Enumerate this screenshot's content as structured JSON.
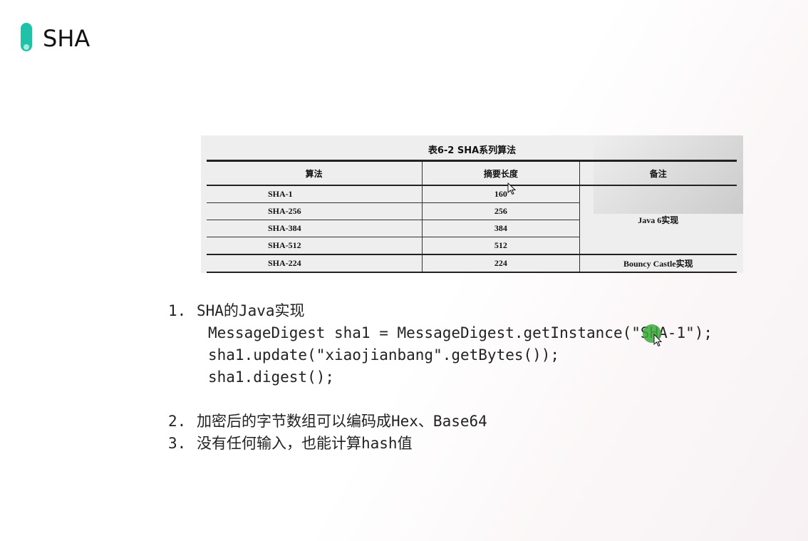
{
  "slide": {
    "title": "SHA",
    "accent_color": "#1fc1a8"
  },
  "table": {
    "caption": "表6-2  SHA系列算法",
    "headers": [
      "算法",
      "摘要长度",
      "备注"
    ],
    "rows": [
      {
        "algorithm": "SHA-1",
        "length": "160"
      },
      {
        "algorithm": "SHA-256",
        "length": "256"
      },
      {
        "algorithm": "SHA-384",
        "length": "384"
      },
      {
        "algorithm": "SHA-512",
        "length": "512"
      },
      {
        "algorithm": "SHA-224",
        "length": "224"
      }
    ],
    "note_java": "Java 6实现",
    "note_bc": "Bouncy Castle实现"
  },
  "list": {
    "item1_num": "1.",
    "item1_text": "SHA的Java实现",
    "code_line1": "MessageDigest sha1 = MessageDigest.getInstance(\"SHA-1\");",
    "code_line2": "sha1.update(\"xiaojianbang\".getBytes());",
    "code_line3": "sha1.digest();",
    "item2_num": "2.",
    "item2_text": "加密后的字节数组可以编码成Hex、Base64",
    "item3_num": "3.",
    "item3_text": "没有任何输入，也能计算hash值"
  }
}
